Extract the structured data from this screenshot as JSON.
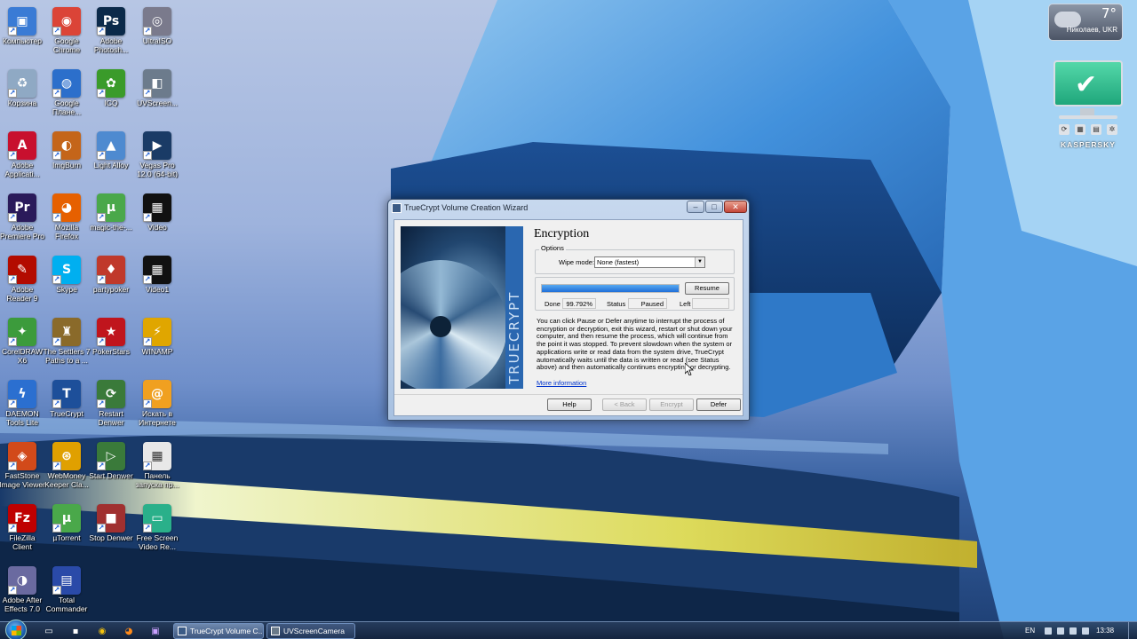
{
  "desktop": {
    "icons": [
      {
        "label": "Компьютер",
        "color": "#3a7bd5",
        "glyph": "▣"
      },
      {
        "label": "Google\nChrome",
        "color": "#db4437",
        "glyph": "◉"
      },
      {
        "label": "Adobe\nPhotosh...",
        "color": "#0b2a4a",
        "glyph": "Ps"
      },
      {
        "label": "UltraISO",
        "color": "#7a7a8c",
        "glyph": "◎"
      },
      {
        "label": "Корзина",
        "color": "#8fa9c4",
        "glyph": "♻"
      },
      {
        "label": "Google\nПлане...",
        "color": "#2c6fcb",
        "glyph": "◍"
      },
      {
        "label": "ICQ",
        "color": "#3a9b2a",
        "glyph": "✿"
      },
      {
        "label": "UVScreen...",
        "color": "#6c7b8c",
        "glyph": "◧"
      },
      {
        "label": "Adobe\nApplicati...",
        "color": "#c8102e",
        "glyph": "A"
      },
      {
        "label": "ImgBurn",
        "color": "#c4651a",
        "glyph": "◐"
      },
      {
        "label": "Light Alloy",
        "color": "#4e8ad0",
        "glyph": "▲"
      },
      {
        "label": "Vegas Pro\n12.0 (64-bit)",
        "color": "#1a3b66",
        "glyph": "▶"
      },
      {
        "label": "Adobe\nPremiere Pro",
        "color": "#2a1a5a",
        "glyph": "Pr"
      },
      {
        "label": "Mozilla\nFirefox",
        "color": "#e66000",
        "glyph": "◕"
      },
      {
        "label": "magic-the-...",
        "color": "#4aa84a",
        "glyph": "μ"
      },
      {
        "label": "Video",
        "color": "#111111",
        "glyph": "▦"
      },
      {
        "label": "Adobe\nReader 9",
        "color": "#b30b00",
        "glyph": "✎"
      },
      {
        "label": "Skype",
        "color": "#00aff0",
        "glyph": "S"
      },
      {
        "label": "partypoker",
        "color": "#c0392b",
        "glyph": "♦"
      },
      {
        "label": "Video1",
        "color": "#111111",
        "glyph": "▦"
      },
      {
        "label": "CorelDRAW\nX6",
        "color": "#3c9b3c",
        "glyph": "✦"
      },
      {
        "label": "The Settlers 7\nPaths to a ...",
        "color": "#8a6a2a",
        "glyph": "♜"
      },
      {
        "label": "PokerStars",
        "color": "#c0151d",
        "glyph": "★"
      },
      {
        "label": "WINAMP",
        "color": "#e0a600",
        "glyph": "⚡"
      },
      {
        "label": "DAEMON\nTools Lite",
        "color": "#2b6fd0",
        "glyph": "ϟ"
      },
      {
        "label": "TrueCrypt",
        "color": "#1d4f9a",
        "glyph": "T"
      },
      {
        "label": "Restart\nDenwer",
        "color": "#3a7a3a",
        "glyph": "⟳"
      },
      {
        "label": "Искать в\nИнтернете",
        "color": "#f0a020",
        "glyph": "@"
      },
      {
        "label": "FastStone\nImage Viewer",
        "color": "#d24a1a",
        "glyph": "◈"
      },
      {
        "label": "WebMoney\nKeeper Cla...",
        "color": "#e0a000",
        "glyph": "⊛"
      },
      {
        "label": "Start Denwer",
        "color": "#3a7a3a",
        "glyph": "▷"
      },
      {
        "label": "Панель\nзапуска пр...",
        "color": "#e8e8e8",
        "glyph": "▦"
      },
      {
        "label": "FileZilla\nClient",
        "color": "#bf0000",
        "glyph": "Fz"
      },
      {
        "label": "µTorrent",
        "color": "#4aa84a",
        "glyph": "μ"
      },
      {
        "label": "Stop Denwer",
        "color": "#a03030",
        "glyph": "■"
      },
      {
        "label": "Free Screen\nVideo Re...",
        "color": "#2ab08a",
        "glyph": "▭"
      },
      {
        "label": "Adobe After\nEffects 7.0",
        "color": "#6a6aa0",
        "glyph": "◑"
      },
      {
        "label": "Total\nCommander",
        "color": "#2a4aa8",
        "glyph": "▤"
      }
    ]
  },
  "gadgets": {
    "weather": {
      "temp": "7°",
      "city": "Николаев, UKR"
    },
    "kaspersky": {
      "brand": "KASPERSKY",
      "status_icon": "check-icon"
    }
  },
  "dialog": {
    "title": "TrueCrypt Volume Creation Wizard",
    "banner_text": "TRUECRYPT",
    "heading": "Encryption",
    "options": {
      "legend": "Options",
      "wipe_label": "Wipe mode:",
      "wipe_value": "None (fastest)"
    },
    "progress": {
      "percent_complete": 99.792,
      "done_label": "Done",
      "done_value": "99.792%",
      "status_label": "Status",
      "status_value": "Paused",
      "left_label": "Left",
      "left_value": "",
      "resume_label": "Resume"
    },
    "info_text": "You can click Pause or Defer anytime to interrupt the process of encryption or decryption, exit this wizard, restart or shut down your computer, and then resume the process, which will continue from the point it was stopped. To prevent slowdown when the system or applications write or read data from the system drive, TrueCrypt automatically waits until the data is written or read (see Status above) and then automatically continues encrypting or decrypting.",
    "more_info": "More information",
    "buttons": {
      "help": "Help",
      "back": "< Back",
      "encrypt": "Encrypt",
      "defer": "Defer"
    }
  },
  "taskbar": {
    "tasks": [
      {
        "label": "TrueCrypt Volume C...",
        "active": true
      },
      {
        "label": "UVScreenCamera",
        "active": false
      }
    ],
    "lang": "EN",
    "clock": "13:38"
  },
  "colors": {
    "progress_fill": "#1f6fd8",
    "link": "#0033cc"
  }
}
